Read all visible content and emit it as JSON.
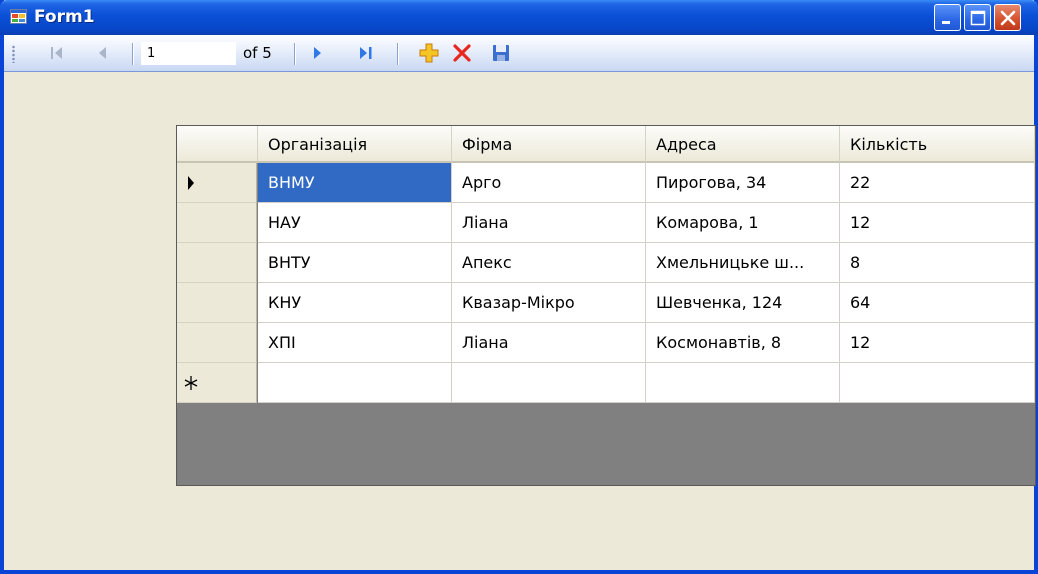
{
  "window": {
    "title": "Form1",
    "icon": "form-app-icon",
    "buttons": [
      "minimize-icon",
      "maximize-icon",
      "close-icon"
    ]
  },
  "navigator": {
    "position": "1",
    "count_label": "of 5",
    "icons": [
      "move-first-icon",
      "move-previous-icon",
      "move-next-icon",
      "move-last-icon",
      "add-new-icon",
      "delete-icon",
      "save-icon"
    ]
  },
  "grid": {
    "columns": [
      "Організація",
      "Фірма",
      "Адреса",
      "Кількість"
    ],
    "rows": [
      [
        "ВНМУ",
        "Арго",
        "Пирогова, 34",
        "22"
      ],
      [
        "НАУ",
        "Ліана",
        "Комарова, 1",
        "12"
      ],
      [
        "ВНТУ",
        "Апекс",
        "Хмельницьке ш...",
        "8"
      ],
      [
        "КНУ",
        "Квазар-Мікро",
        "Шевченка, 124",
        "64"
      ],
      [
        "ХПІ",
        "Ліана",
        "Космонавтів, 8",
        "12"
      ]
    ],
    "current_row_marker": "current-row-arrow-icon",
    "new_row_marker": "new-row-asterisk-icon",
    "selected_cell": {
      "row": 1,
      "col": 1
    },
    "colors": {
      "selection": "#316ac5",
      "grid_background": "#808080"
    }
  }
}
